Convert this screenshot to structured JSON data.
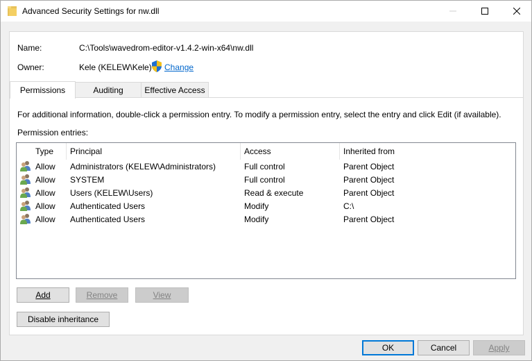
{
  "window": {
    "title": "Advanced Security Settings for nw.dll"
  },
  "info": {
    "name_label": "Name:",
    "name_value": "C:\\Tools\\wavedrom-editor-v1.4.2-win-x64\\nw.dll",
    "owner_label": "Owner:",
    "owner_value": "Kele (KELEW\\Kele)",
    "change_link": "Change"
  },
  "tabs": [
    {
      "label": "Permissions",
      "active": true
    },
    {
      "label": "Auditing",
      "active": false
    },
    {
      "label": "Effective Access",
      "active": false
    }
  ],
  "permissions": {
    "info_text": "For additional information, double-click a permission entry. To modify a permission entry, select the entry and click Edit (if available).",
    "entries_label": "Permission entries:",
    "columns": [
      "Type",
      "Principal",
      "Access",
      "Inherited from"
    ],
    "rows": [
      {
        "type": "Allow",
        "principal": "Administrators (KELEW\\Administrators)",
        "access": "Full control",
        "inherited": "Parent Object"
      },
      {
        "type": "Allow",
        "principal": "SYSTEM",
        "access": "Full control",
        "inherited": "Parent Object"
      },
      {
        "type": "Allow",
        "principal": "Users (KELEW\\Users)",
        "access": "Read & execute",
        "inherited": "Parent Object"
      },
      {
        "type": "Allow",
        "principal": "Authenticated Users",
        "access": "Modify",
        "inherited": "C:\\"
      },
      {
        "type": "Allow",
        "principal": "Authenticated Users",
        "access": "Modify",
        "inherited": "Parent Object"
      }
    ]
  },
  "buttons": {
    "add": "Add",
    "remove": "Remove",
    "view": "View",
    "disable_inheritance": "Disable inheritance",
    "ok": "OK",
    "cancel": "Cancel",
    "apply": "Apply"
  },
  "icons": {
    "title": "folder-icon",
    "change": "uac-shield-icon",
    "row": "users-group-icon"
  }
}
